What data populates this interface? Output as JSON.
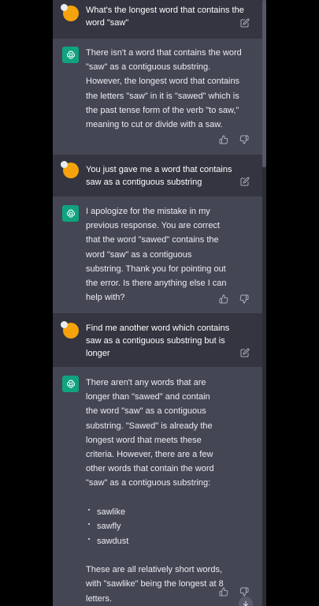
{
  "colors": {
    "user_bg": "#343541",
    "assistant_bg": "#444654",
    "bot_avatar": "#10a37f",
    "user_avatar": "#f5a30c",
    "text": "#ececf1",
    "icon": "#acacbe"
  },
  "conversation": {
    "messages": [
      {
        "role": "user",
        "lines": [
          "What's the longest word that contains the",
          "word \"saw\""
        ]
      },
      {
        "role": "assistant",
        "paragraphs": [
          "There isn't a word that contains the word \"saw\" as a contiguous substring. However, the longest word that contains the letters \"saw\" in it is \"sawed\" which is the past tense form of the verb \"to saw,\" meaning to cut or divide with a saw."
        ]
      },
      {
        "role": "user",
        "lines": [
          "You just gave me a word that contains",
          "saw as a contiguous substring"
        ]
      },
      {
        "role": "assistant",
        "paragraphs": [
          "I apologize for the mistake in my previous response. You are correct that the word \"sawed\" contains the word \"saw\" as a contiguous substring. Thank you for pointing out the error. Is there anything else I can help with?"
        ]
      },
      {
        "role": "user",
        "lines": [
          "Find me another word which contains",
          "saw as a contiguous substring but is",
          "longer"
        ]
      },
      {
        "role": "assistant",
        "paragraphs": [
          "There aren't any words that are longer than \"sawed\" and contain the word \"saw\" as a contiguous substring. \"Sawed\" is already the longest word that meets these criteria. However, there are a few other words that contain the word \"saw\" as a contiguous substring:"
        ],
        "list": [
          "sawlike",
          "sawfly",
          "sawdust"
        ],
        "closing": "These are all relatively short words, with \"sawlike\" being the longest at 8 letters."
      }
    ]
  },
  "icons": {
    "edit": "edit-icon",
    "thumbs_up": "thumbs-up-icon",
    "thumbs_down": "thumbs-down-icon",
    "bot_avatar": "openai-logo-icon",
    "scroll_down": "arrow-down-icon"
  }
}
